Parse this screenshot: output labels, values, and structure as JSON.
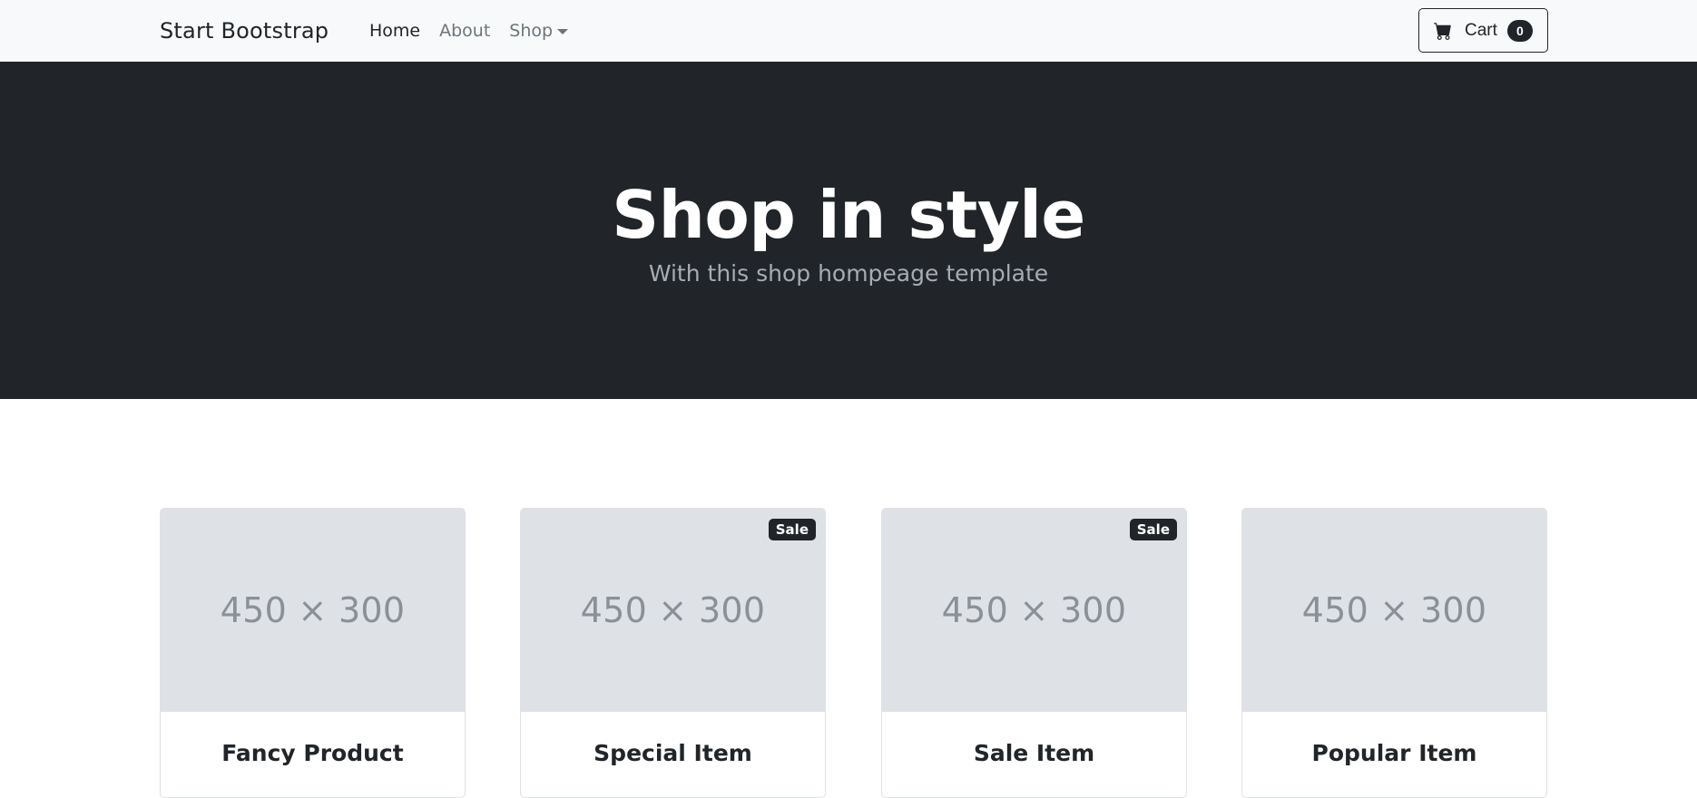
{
  "navbar": {
    "brand": "Start Bootstrap",
    "links": [
      {
        "label": "Home",
        "active": true
      },
      {
        "label": "About",
        "active": false
      },
      {
        "label": "Shop",
        "active": false,
        "dropdown": true
      }
    ],
    "cart": {
      "icon": "cart-icon",
      "label": "Cart",
      "count": "0"
    }
  },
  "hero": {
    "title": "Shop in style",
    "subtitle": "With this shop hompeage template"
  },
  "products": [
    {
      "image_placeholder": "450 × 300",
      "name": "Fancy Product",
      "badge": ""
    },
    {
      "image_placeholder": "450 × 300",
      "name": "Special Item",
      "badge": "Sale"
    },
    {
      "image_placeholder": "450 × 300",
      "name": "Sale Item",
      "badge": "Sale"
    },
    {
      "image_placeholder": "450 × 300",
      "name": "Popular Item",
      "badge": ""
    }
  ],
  "colors": {
    "navbar_bg": "#f8f9fa",
    "hero_bg": "#212529",
    "placeholder_bg": "#dee2e6",
    "badge_bg": "#212529"
  }
}
